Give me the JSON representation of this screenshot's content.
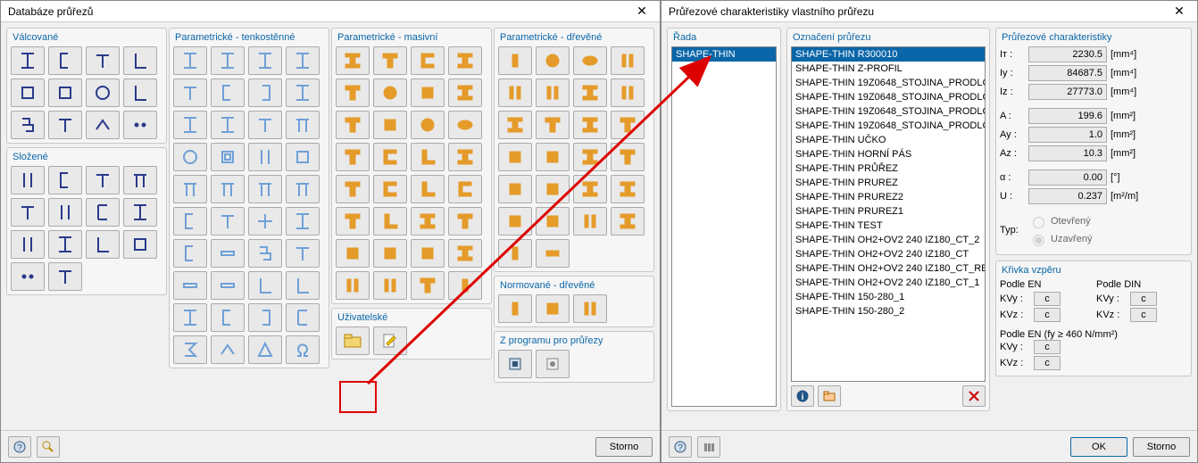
{
  "left_dialog": {
    "title": "Databáze průřezů",
    "groups": {
      "valcovane": "Válcované",
      "parametricke_tenko": "Parametrické - tenkostěnné",
      "parametricke_masiv": "Parametrické - masivní",
      "parametricke_drev": "Parametrické - dřevěné",
      "slozene": "Složené",
      "normovane_drev": "Normované - dřevěné",
      "uzivatelske": "Uživatelské",
      "z_programu": "Z programu pro průřezy"
    },
    "storno": "Storno"
  },
  "right_dialog": {
    "title": "Průřezové charakteristiky vlastního průřezu",
    "panels": {
      "rada": "Řada",
      "oznaceni": "Označení průřezu",
      "chars": "Průřezové charakteristiky",
      "buckle": "Křivka vzpěru"
    },
    "rada_items": [
      "SHAPE-THIN"
    ],
    "ozn_items": [
      "SHAPE-THIN R300010",
      "SHAPE-THIN Z-PROFIL",
      "SHAPE-THIN 19Z0648_STOJINA_PRODLC",
      "SHAPE-THIN 19Z0648_STOJINA_PRODLC",
      "SHAPE-THIN 19Z0648_STOJINA_PRODLC",
      "SHAPE-THIN 19Z0648_STOJINA_PRODLC",
      "SHAPE-THIN UČKO",
      "SHAPE-THIN HORNÍ PÁS",
      "SHAPE-THIN PRŮŘEZ",
      "SHAPE-THIN PRUREZ",
      "SHAPE-THIN PRUREZ2",
      "SHAPE-THIN PRUREZ1",
      "SHAPE-THIN TEST",
      "SHAPE-THIN OH2+OV2 240 IZ180_CT_2",
      "SHAPE-THIN OH2+OV2 240 IZ180_CT",
      "SHAPE-THIN OH2+OV2 240 IZ180_CT_RE",
      "SHAPE-THIN OH2+OV2 240 IZ180_CT_1",
      "SHAPE-THIN 150-280_1",
      "SHAPE-THIN 150-280_2"
    ],
    "chars": [
      {
        "lbl": "Iᴛ :",
        "val": "2230.5",
        "unit": "[mm⁴]"
      },
      {
        "lbl": "Iy :",
        "val": "84687.5",
        "unit": "[mm⁴]"
      },
      {
        "lbl": "Iz :",
        "val": "27773.0",
        "unit": "[mm⁴]"
      },
      {
        "lbl": "A :",
        "val": "199.6",
        "unit": "[mm²]"
      },
      {
        "lbl": "Ay :",
        "val": "1.0",
        "unit": "[mm²]"
      },
      {
        "lbl": "Az :",
        "val": "10.3",
        "unit": "[mm²]"
      },
      {
        "lbl": "α :",
        "val": "0.00",
        "unit": "[°]"
      },
      {
        "lbl": "U :",
        "val": "0.237",
        "unit": "[m²/m]"
      }
    ],
    "typ_label": "Typ:",
    "typ_open": "Otevřený",
    "typ_closed": "Uzavřený",
    "buckle": {
      "en": "Podle EN",
      "din": "Podle DIN",
      "kvy": "KVy :",
      "kvz": "KVz :",
      "val": "c",
      "en460": "Podle EN (fy ≥ 460 N/mm²)"
    },
    "ok": "OK",
    "storno": "Storno"
  }
}
